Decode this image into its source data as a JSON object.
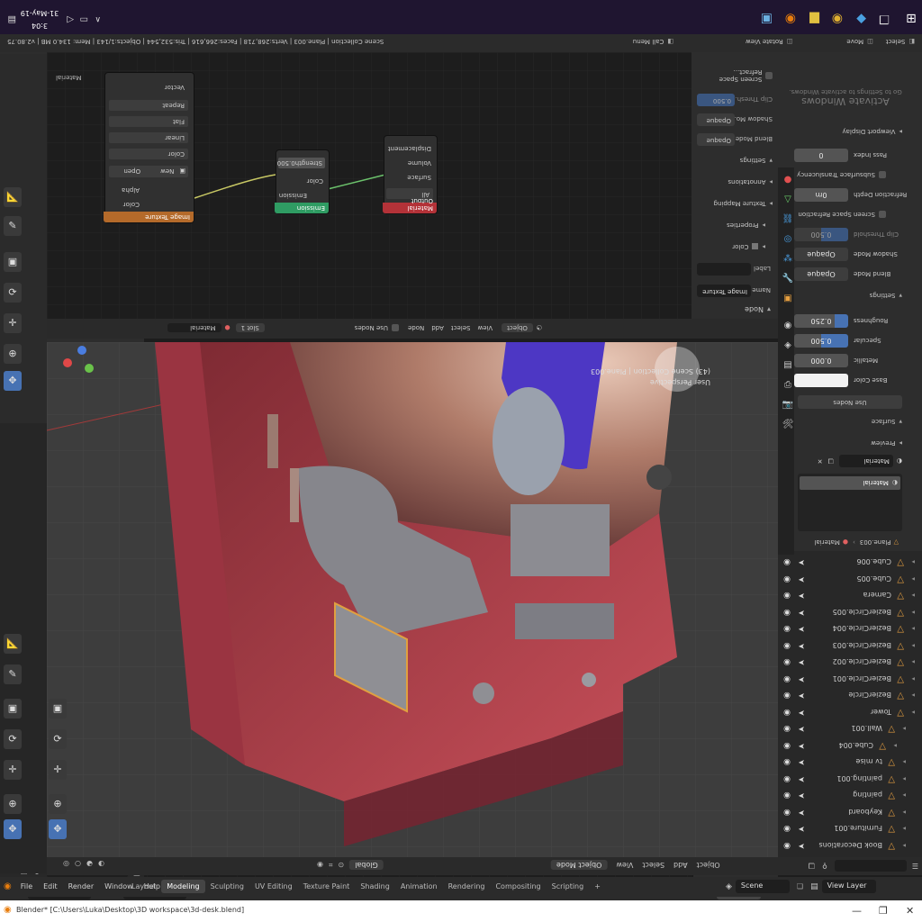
{
  "window": {
    "title": "Blender* [C:\\Users\\Luka\\Desktop\\3D workspace\\3d-desk.blend]",
    "controls": [
      "—",
      "❐",
      "✕"
    ]
  },
  "menubar": {
    "menus": [
      "File",
      "Edit",
      "Render",
      "Window",
      "Help"
    ],
    "workspaces": [
      "Layout",
      "Modeling",
      "Sculpting",
      "UV Editing",
      "Texture Paint",
      "Shading",
      "Animation",
      "Rendering",
      "Compositing",
      "Scripting"
    ],
    "active_workspace": "Modeling",
    "scene": "Scene",
    "view_layer": "View Layer"
  },
  "viewport": {
    "mode": "Object Mode",
    "menu": [
      "View",
      "Select",
      "Add",
      "Object"
    ],
    "transform": "Global",
    "overlay_line1": "User Perspective",
    "overlay_line2": "(43) Scene Collection | Plane.003"
  },
  "node_editor": {
    "header_mode": "Object",
    "menu": [
      "View",
      "Select",
      "Add",
      "Node"
    ],
    "use_nodes": "Use Nodes",
    "slot": "Slot 1",
    "material": "Material",
    "label_material": "Material",
    "nodes": {
      "image_texture": {
        "title": "Image Texture",
        "outputs": [
          "Color",
          "Alpha"
        ],
        "new_btn": "New",
        "open_btn": "Open",
        "interp": "Linear",
        "proj": "Flat",
        "ext": "Repeat",
        "colorspace": "Color",
        "input": "Vector"
      },
      "emission": {
        "title": "Emission",
        "output": "Emission",
        "color": "Color",
        "strength_label": "Strength",
        "strength": "0.500"
      },
      "material_output": {
        "title": "Material Output",
        "target": "All",
        "inputs": [
          "Surface",
          "Volume",
          "Displacement"
        ]
      }
    },
    "sidebar": {
      "section_node": "Node",
      "name_label": "Name",
      "name_value": "Image Texture",
      "label_label": "Label",
      "color": "Color",
      "properties": "Properties",
      "texture_mapping": "Texture Mapping",
      "annotations": "Annotations",
      "settings": "Settings",
      "blend_mode_label": "Blend Mode",
      "blend_mode": "Opaque",
      "shadow_mode_label": "Shadow Mo...",
      "shadow_mode": "Opaque",
      "clip_thresh_label": "Clip Thresh...",
      "clip_thresh": "0.500",
      "screen_space": "Screen Space Refract..."
    }
  },
  "outliner": {
    "items": [
      {
        "label": "Book Decorations",
        "depth": 1
      },
      {
        "label": "Furniture.001",
        "depth": 1
      },
      {
        "label": "Keyboard",
        "depth": 1
      },
      {
        "label": "painting",
        "depth": 1
      },
      {
        "label": "painting.001",
        "depth": 1
      },
      {
        "label": "tv mise",
        "depth": 1
      },
      {
        "label": "Cube.004",
        "depth": 2
      },
      {
        "label": "Wall.001",
        "depth": 1
      },
      {
        "label": "Tower",
        "depth": 0
      },
      {
        "label": "BezierCircle",
        "depth": 0
      },
      {
        "label": "BezierCircle.001",
        "depth": 0
      },
      {
        "label": "BezierCircle.002",
        "depth": 0
      },
      {
        "label": "BezierCircle.003",
        "depth": 0
      },
      {
        "label": "BezierCircle.004",
        "depth": 0
      },
      {
        "label": "BezierCircle.005",
        "depth": 0
      },
      {
        "label": "Camera",
        "depth": 0
      },
      {
        "label": "Cube.005",
        "depth": 0
      },
      {
        "label": "Cube.006",
        "depth": 0
      }
    ]
  },
  "properties": {
    "breadcrumb_object": "Plane.003",
    "breadcrumb_material": "Material",
    "slot_item": "Material",
    "material_name": "Material",
    "preview": "Preview",
    "surface": "Surface",
    "use_nodes": "Use Nodes",
    "base_color_label": "Base Color",
    "metallic_label": "Metallic",
    "metallic": "0.000",
    "specular_label": "Specular",
    "specular": "0.500",
    "roughness_label": "Roughness",
    "roughness": "0.250",
    "settings": "Settings",
    "blend_mode_label": "Blend Mode",
    "blend_mode": "Opaque",
    "shadow_mode_label": "Shadow Mode",
    "shadow_mode": "Opaque",
    "clip_threshold_label": "Clip Threshold",
    "clip_threshold": "0.500",
    "screen_space_refraction": "Screen Space Refraction",
    "refraction_depth_label": "Refraction Depth",
    "refraction_depth": "0m",
    "subsurface_translucency": "Subsurface Translucency",
    "pass_index_label": "Pass Index",
    "pass_index": "0",
    "viewport_display": "Viewport Display",
    "watermark1": "Activate Windows",
    "watermark2": "Go to Settings to activate Windows."
  },
  "statusbar": {
    "select": "Select",
    "move": "Move",
    "rotate": "Rotate View",
    "call_menu": "Call Menu",
    "stats": "Scene Collection | Plane.003 | Verts:268,718 | Faces:266,616 | Tris:532,544 | Objects:1/143 | Mem: 134.0 MB | v2.80.75"
  },
  "taskbar": {
    "time": "3:04",
    "date": "31-May-19"
  },
  "colors": {
    "accent": "#4772b3",
    "image_tex_header": "#b46a2a",
    "emission_header": "#2f9c63",
    "output_header": "#b33238",
    "wall_red": "#b8434b",
    "floor_red": "#a8303c"
  }
}
